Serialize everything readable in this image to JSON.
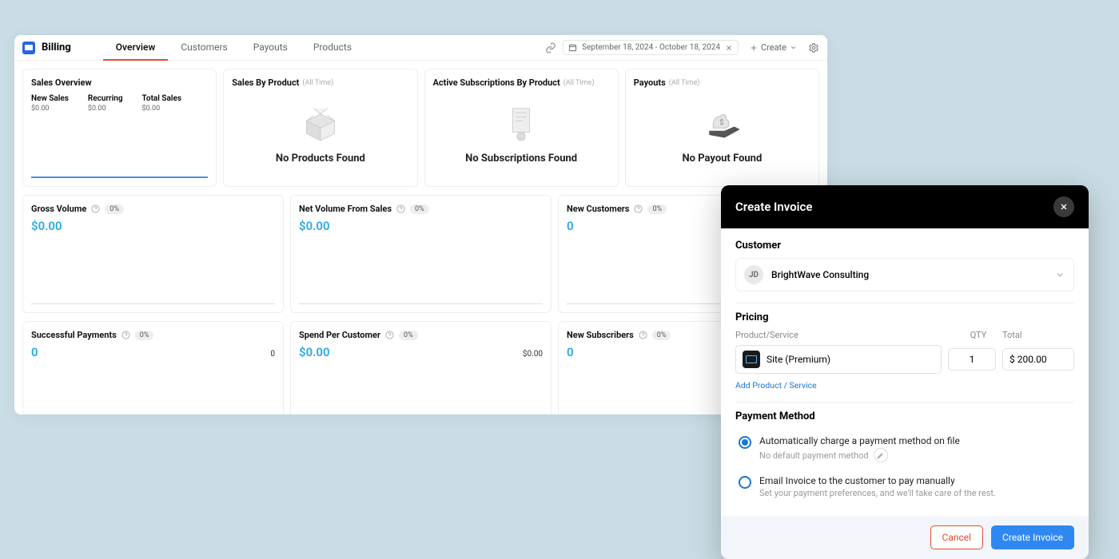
{
  "app": {
    "title": "Billing"
  },
  "nav": {
    "items": [
      "Overview",
      "Customers",
      "Payouts",
      "Products"
    ]
  },
  "topbar": {
    "date_range": "September 18, 2024 - October 18, 2024",
    "create_label": "Create"
  },
  "sales_overview": {
    "title": "Sales Overview",
    "cols": [
      {
        "label": "New Sales",
        "value": "$0.00"
      },
      {
        "label": "Recurring",
        "value": "$0.00"
      },
      {
        "label": "Total Sales",
        "value": "$0.00"
      }
    ]
  },
  "sales_by_product": {
    "title": "Sales By Product",
    "tag": "(All Time)",
    "empty": "No Products Found"
  },
  "subs_by_product": {
    "title": "Active Subscriptions By Product",
    "tag": "(All Time)",
    "empty": "No Subscriptions Found"
  },
  "payouts": {
    "title": "Payouts",
    "tag": "(All Time)",
    "empty": "No Payout Found"
  },
  "metrics": {
    "gross": {
      "title": "Gross Volume",
      "badge": "0%",
      "value": "$0.00"
    },
    "net": {
      "title": "Net Volume From Sales",
      "badge": "0%",
      "value": "$0.00"
    },
    "newc": {
      "title": "New Customers",
      "badge": "0%",
      "value": "0"
    },
    "succ": {
      "title": "Successful Payments",
      "badge": "0%",
      "value": "0",
      "sub": "0"
    },
    "spend": {
      "title": "Spend Per Customer",
      "badge": "0%",
      "value": "$0.00",
      "sub": "$0.00"
    },
    "subs": {
      "title": "New Subscribers",
      "badge": "0%",
      "value": "0"
    }
  },
  "modal": {
    "title": "Create Invoice",
    "customer_label": "Customer",
    "customer_initials": "JD",
    "customer_name": "BrightWave Consulting",
    "pricing_label": "Pricing",
    "col_product": "Product/Service",
    "col_qty": "QTY",
    "col_total": "Total",
    "product_name": "Site (Premium)",
    "qty": "1",
    "total": "$ 200.00",
    "add_link": "Add Product / Service",
    "pm_label": "Payment Method",
    "pm1": {
      "label": "Automatically charge a payment method on file",
      "sub": "No default payment method"
    },
    "pm2": {
      "label": "Email Invoice to the customer to pay manually",
      "sub": "Set your payment preferences, and we'll take care of the rest."
    },
    "cancel": "Cancel",
    "create": "Create Invoice"
  }
}
